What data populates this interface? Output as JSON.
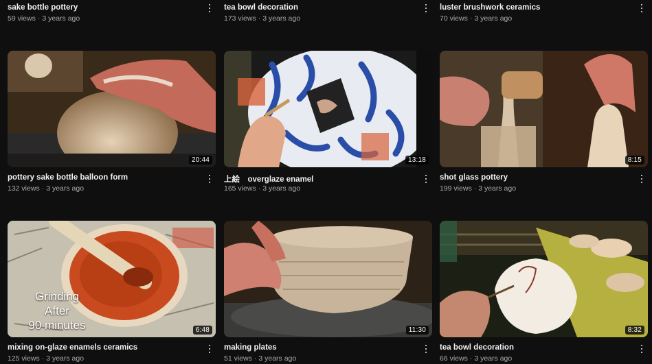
{
  "top_row": [
    {
      "title": "sake bottle pottery",
      "views": "59 views",
      "age": "3 years ago"
    },
    {
      "title": "tea bowl decoration",
      "views": "173 views",
      "age": "3 years ago"
    },
    {
      "title": "luster brushwork ceramics",
      "views": "70 views",
      "age": "3 years ago"
    }
  ],
  "middle_row": [
    {
      "title": "pottery sake bottle balloon form",
      "views": "132 views",
      "age": "3 years ago",
      "duration": "20:44"
    },
    {
      "title": "上絵　overglaze enamel",
      "views": "165 views",
      "age": "3 years ago",
      "duration": "13:18"
    },
    {
      "title": "shot glass pottery",
      "views": "199 views",
      "age": "3 years ago",
      "duration": "8:15"
    }
  ],
  "bottom_row": [
    {
      "title": "mixing on-glaze enamels ceramics",
      "views": "125 views",
      "age": "3 years ago",
      "duration": "6:48",
      "overlay": [
        "Grinding",
        "After",
        "90 minutes"
      ]
    },
    {
      "title": "making plates",
      "views": "51 views",
      "age": "3 years ago",
      "duration": "11:30"
    },
    {
      "title": "tea bowl decoration",
      "views": "66 views",
      "age": "3 years ago",
      "duration": "8:32"
    }
  ],
  "more_icon": "three-dots-vertical-icon",
  "separator": "·"
}
